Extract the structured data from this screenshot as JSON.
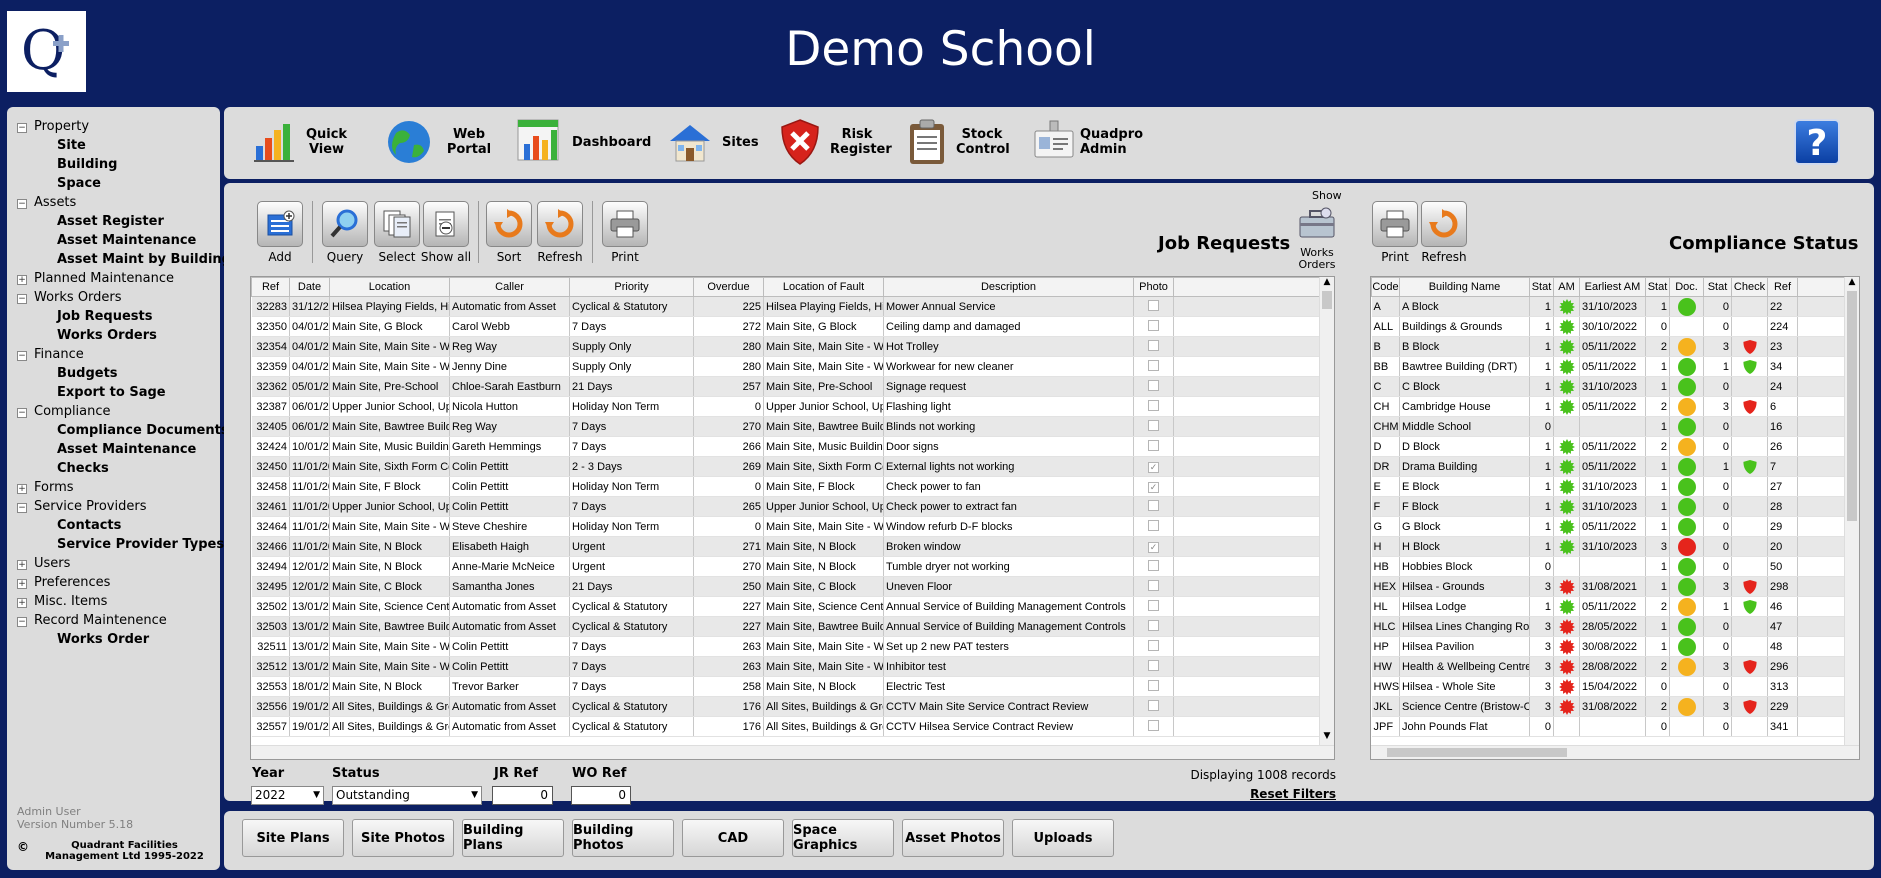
{
  "header": {
    "title": "Demo School"
  },
  "sidebar": {
    "items": [
      {
        "label": "Property",
        "type": "group",
        "toggle": "−"
      },
      {
        "label": "Site",
        "type": "sub"
      },
      {
        "label": "Building",
        "type": "sub"
      },
      {
        "label": "Space",
        "type": "sub"
      },
      {
        "label": "Assets",
        "type": "group",
        "toggle": "−"
      },
      {
        "label": "Asset Register",
        "type": "sub"
      },
      {
        "label": "Asset Maintenance",
        "type": "sub"
      },
      {
        "label": "Asset Maint by Building",
        "type": "sub"
      },
      {
        "label": "Planned Maintenance",
        "type": "group",
        "toggle": "+"
      },
      {
        "label": "Works Orders",
        "type": "group",
        "toggle": "−"
      },
      {
        "label": "Job Requests",
        "type": "sub"
      },
      {
        "label": "Works Orders",
        "type": "sub"
      },
      {
        "label": "Finance",
        "type": "group",
        "toggle": "−"
      },
      {
        "label": "Budgets",
        "type": "sub"
      },
      {
        "label": "Export to Sage",
        "type": "sub"
      },
      {
        "label": "Compliance",
        "type": "group",
        "toggle": "−"
      },
      {
        "label": "Compliance Documents",
        "type": "sub"
      },
      {
        "label": "Asset Maintenance",
        "type": "sub"
      },
      {
        "label": "Checks",
        "type": "sub"
      },
      {
        "label": "Forms",
        "type": "group",
        "toggle": "+"
      },
      {
        "label": "Service Providers",
        "type": "group",
        "toggle": "−"
      },
      {
        "label": "Contacts",
        "type": "sub"
      },
      {
        "label": "Service Provider Types",
        "type": "sub"
      },
      {
        "label": "Users",
        "type": "group",
        "toggle": "+"
      },
      {
        "label": "Preferences",
        "type": "group",
        "toggle": "+"
      },
      {
        "label": "Misc. Items",
        "type": "group",
        "toggle": "+"
      },
      {
        "label": "Record Maintenence",
        "type": "group",
        "toggle": "−"
      },
      {
        "label": "Works Order",
        "type": "sub"
      }
    ],
    "user": "Admin User",
    "version": "Version Number 5.18",
    "copyright_symbol": "©",
    "copyright": "Quadrant Facilities Management Ltd 1995-2022"
  },
  "topbar": {
    "quick_view": "Quick View",
    "web_portal": "Web Portal",
    "dashboard": "Dashboard",
    "sites": "Sites",
    "risk_register": "Risk Register",
    "stock_control": "Stock Control",
    "quadpro_admin": "Quadpro Admin",
    "help": "?"
  },
  "jobs": {
    "title": "Job Requests",
    "toolbar": {
      "add": "Add",
      "query": "Query",
      "select": "Select",
      "show_all": "Show all",
      "sort": "Sort",
      "refresh": "Refresh",
      "print": "Print",
      "show": "Show",
      "works_orders": "Works Orders"
    },
    "columns": [
      "Ref",
      "Date",
      "Location",
      "Caller",
      "Priority",
      "Overdue",
      "Location of Fault",
      "Description",
      "Photo"
    ],
    "rows": [
      [
        "32283",
        "31/12/2021",
        "Hilsea Playing Fields, Hils",
        "Automatic from Asset",
        "Cyclical & Statutory",
        "225",
        "Hilsea Playing Fields, Hils",
        "Mower Annual Service",
        false
      ],
      [
        "32350",
        "04/01/2022",
        "Main Site, G Block",
        "Carol Webb",
        "7 Days",
        "272",
        "Main Site, G Block",
        "Ceiling damp and damaged",
        false
      ],
      [
        "32354",
        "04/01/2022",
        "Main Site, Main Site - Wh",
        "Reg Way",
        "Supply Only",
        "280",
        "Main Site, Main Site - Wh",
        "Hot Trolley",
        false
      ],
      [
        "32359",
        "04/01/2022",
        "Main Site, Main Site - Wh",
        "Jenny Dine",
        "Supply Only",
        "280",
        "Main Site, Main Site - Wh",
        "Workwear for new cleaner",
        false
      ],
      [
        "32362",
        "05/01/2022",
        "Main Site, Pre-School",
        "Chloe-Sarah Eastburn",
        "21 Days",
        "257",
        "Main Site, Pre-School",
        "Signage request",
        false
      ],
      [
        "32387",
        "06/01/2022",
        "Upper Junior School, Upp",
        "Nicola Hutton",
        "Holiday Non Term",
        "0",
        "Upper Junior School, Upp",
        "Flashing light",
        false
      ],
      [
        "32405",
        "06/01/2022",
        "Main Site, Bawtree Buildi",
        "Reg Way",
        "7 Days",
        "270",
        "Main Site, Bawtree Buildi",
        "Blinds not working",
        false
      ],
      [
        "32424",
        "10/01/2022",
        "Main Site, Music Building",
        "Gareth Hemmings",
        "7 Days",
        "266",
        "Main Site, Music Building",
        "Door signs",
        false
      ],
      [
        "32450",
        "11/01/2022",
        "Main Site, Sixth Form Ce",
        "Colin Pettitt",
        "2 - 3 Days",
        "269",
        "Main Site, Sixth Form Ce",
        "External lights not working",
        true
      ],
      [
        "32458",
        "11/01/2022",
        "Main Site, F Block",
        "Colin Pettitt",
        "Holiday Non Term",
        "0",
        "Main Site, F Block",
        "Check power to fan",
        true
      ],
      [
        "32461",
        "11/01/2022",
        "Upper Junior School, Upp",
        "Colin Pettitt",
        "7 Days",
        "265",
        "Upper Junior School, Upp",
        "Check power to extract fan",
        false
      ],
      [
        "32464",
        "11/01/2022",
        "Main Site, Main Site - Wh",
        "Steve Cheshire",
        "Holiday Non Term",
        "0",
        "Main Site, Main Site - Wh",
        "Window refurb D-F blocks",
        false
      ],
      [
        "32466",
        "11/01/2022",
        "Main Site, N Block",
        "Elisabeth Haigh",
        "Urgent",
        "271",
        "Main Site, N Block",
        "Broken window",
        true
      ],
      [
        "32494",
        "12/01/2022",
        "Main Site, N Block",
        "Anne-Marie McNeice",
        "Urgent",
        "270",
        "Main Site, N Block",
        "Tumble dryer not working",
        false
      ],
      [
        "32495",
        "12/01/2022",
        "Main Site, C Block",
        "Samantha Jones",
        "21 Days",
        "250",
        "Main Site, C Block",
        "Uneven Floor",
        false
      ],
      [
        "32502",
        "13/01/2022",
        "Main Site, Science Centr",
        "Automatic from Asset",
        "Cyclical & Statutory",
        "227",
        "Main Site, Science Centr",
        "Annual Service of Building Management Controls",
        false
      ],
      [
        "32503",
        "13/01/2022",
        "Main Site, Bawtree Buildi",
        "Automatic from Asset",
        "Cyclical & Statutory",
        "227",
        "Main Site, Bawtree Buildi",
        "Annual Service of Building Management Controls",
        false
      ],
      [
        "32511",
        "13/01/2022",
        "Main Site, Main Site - Wh",
        "Colin Pettitt",
        "7 Days",
        "263",
        "Main Site, Main Site - Wh",
        "Set up 2 new PAT testers",
        false
      ],
      [
        "32512",
        "13/01/2022",
        "Main Site, Main Site - Wh",
        "Colin Pettitt",
        "7 Days",
        "263",
        "Main Site, Main Site - Wh",
        "Inhibitor test",
        false
      ],
      [
        "32553",
        "18/01/2022",
        "Main Site, N Block",
        "Trevor Barker",
        "7 Days",
        "258",
        "Main Site, N Block",
        "Electric Test",
        false
      ],
      [
        "32556",
        "19/01/2022",
        "All Sites, Buildings & Grou",
        "Automatic from Asset",
        "Cyclical & Statutory",
        "176",
        "All Sites, Buildings & Grou",
        "CCTV Main Site Service Contract Review",
        false
      ],
      [
        "32557",
        "19/01/2022",
        "All Sites, Buildings & Grou",
        "Automatic from Asset",
        "Cyclical & Statutory",
        "176",
        "All Sites, Buildings & Grou",
        "CCTV Hilsea Service Contract Review",
        false
      ]
    ],
    "filters": {
      "year_label": "Year",
      "year_value": "2022",
      "status_label": "Status",
      "status_value": "Outstanding",
      "jr_label": "JR Ref",
      "jr_value": "0",
      "wo_label": "WO Ref",
      "wo_value": "0",
      "displaying": "Displaying 1008 records",
      "reset": "Reset Filters"
    }
  },
  "compliance": {
    "title": "Compliance Status",
    "toolbar": {
      "print": "Print",
      "refresh": "Refresh"
    },
    "columns": [
      "Code",
      "Building Name",
      "Stat",
      "AM",
      "Earliest AM",
      "Stat",
      "Doc.",
      "Stat",
      "Check",
      "Ref"
    ],
    "rows": [
      {
        "code": "A",
        "name": "A Block",
        "stat1": "1",
        "am": "green",
        "earliest": "31/10/2023",
        "stat2": "1",
        "doc": "green",
        "stat3": "0",
        "check": "",
        "ref": "22"
      },
      {
        "code": "ALL",
        "name": "Buildings & Grounds",
        "stat1": "1",
        "am": "green",
        "earliest": "30/10/2022",
        "stat2": "0",
        "doc": "",
        "stat3": "0",
        "check": "",
        "ref": "224"
      },
      {
        "code": "B",
        "name": "B Block",
        "stat1": "1",
        "am": "green",
        "earliest": "05/11/2022",
        "stat2": "2",
        "doc": "orange",
        "stat3": "3",
        "check": "red",
        "ref": "23"
      },
      {
        "code": "BB",
        "name": "Bawtree Building (DRT)",
        "stat1": "1",
        "am": "green",
        "earliest": "05/11/2022",
        "stat2": "1",
        "doc": "green",
        "stat3": "1",
        "check": "green",
        "ref": "34"
      },
      {
        "code": "C",
        "name": "C Block",
        "stat1": "1",
        "am": "green",
        "earliest": "31/10/2023",
        "stat2": "1",
        "doc": "green",
        "stat3": "0",
        "check": "",
        "ref": "24"
      },
      {
        "code": "CH",
        "name": "Cambridge House",
        "stat1": "1",
        "am": "green",
        "earliest": "05/11/2022",
        "stat2": "2",
        "doc": "orange",
        "stat3": "3",
        "check": "red",
        "ref": "6"
      },
      {
        "code": "CHM",
        "name": "Middle School",
        "stat1": "0",
        "am": "",
        "earliest": "",
        "stat2": "1",
        "doc": "green",
        "stat3": "0",
        "check": "",
        "ref": "16"
      },
      {
        "code": "D",
        "name": "D Block",
        "stat1": "1",
        "am": "green",
        "earliest": "05/11/2022",
        "stat2": "2",
        "doc": "orange",
        "stat3": "0",
        "check": "",
        "ref": "26"
      },
      {
        "code": "DR",
        "name": "Drama Building",
        "stat1": "1",
        "am": "green",
        "earliest": "05/11/2022",
        "stat2": "1",
        "doc": "green",
        "stat3": "1",
        "check": "green",
        "ref": "7"
      },
      {
        "code": "E",
        "name": "E Block",
        "stat1": "1",
        "am": "green",
        "earliest": "31/10/2023",
        "stat2": "1",
        "doc": "green",
        "stat3": "0",
        "check": "",
        "ref": "27"
      },
      {
        "code": "F",
        "name": "F Block",
        "stat1": "1",
        "am": "green",
        "earliest": "31/10/2023",
        "stat2": "1",
        "doc": "green",
        "stat3": "0",
        "check": "",
        "ref": "28"
      },
      {
        "code": "G",
        "name": "G Block",
        "stat1": "1",
        "am": "green",
        "earliest": "05/11/2022",
        "stat2": "1",
        "doc": "green",
        "stat3": "0",
        "check": "",
        "ref": "29"
      },
      {
        "code": "H",
        "name": "H Block",
        "stat1": "1",
        "am": "green",
        "earliest": "31/10/2023",
        "stat2": "3",
        "doc": "red",
        "stat3": "0",
        "check": "",
        "ref": "20"
      },
      {
        "code": "HB",
        "name": "Hobbies Block",
        "stat1": "0",
        "am": "",
        "earliest": "",
        "stat2": "1",
        "doc": "green",
        "stat3": "0",
        "check": "",
        "ref": "50"
      },
      {
        "code": "HEX",
        "name": "Hilsea - Grounds",
        "stat1": "3",
        "am": "red",
        "earliest": "31/08/2021",
        "stat2": "1",
        "doc": "green",
        "stat3": "3",
        "check": "red",
        "ref": "298"
      },
      {
        "code": "HL",
        "name": "Hilsea Lodge",
        "stat1": "1",
        "am": "green",
        "earliest": "05/11/2022",
        "stat2": "2",
        "doc": "orange",
        "stat3": "1",
        "check": "green",
        "ref": "46"
      },
      {
        "code": "HLC",
        "name": "Hilsea Lines Changing Rooms",
        "stat1": "3",
        "am": "red",
        "earliest": "28/05/2022",
        "stat2": "1",
        "doc": "green",
        "stat3": "0",
        "check": "",
        "ref": "47"
      },
      {
        "code": "HP",
        "name": "Hilsea Pavilion",
        "stat1": "3",
        "am": "red",
        "earliest": "30/08/2022",
        "stat2": "1",
        "doc": "green",
        "stat3": "0",
        "check": "",
        "ref": "48"
      },
      {
        "code": "HW",
        "name": "Health & Wellbeing Centre",
        "stat1": "3",
        "am": "red",
        "earliest": "28/08/2022",
        "stat2": "2",
        "doc": "orange",
        "stat3": "3",
        "check": "red",
        "ref": "296"
      },
      {
        "code": "HWS",
        "name": "Hilsea - Whole Site",
        "stat1": "3",
        "am": "red",
        "earliest": "15/04/2022",
        "stat2": "0",
        "doc": "",
        "stat3": "0",
        "check": "",
        "ref": "313"
      },
      {
        "code": "JKL",
        "name": "Science Centre (Bristow-Clavell)",
        "stat1": "3",
        "am": "red",
        "earliest": "31/08/2022",
        "stat2": "2",
        "doc": "orange",
        "stat3": "3",
        "check": "red",
        "ref": "229"
      },
      {
        "code": "JPF",
        "name": "John Pounds Flat",
        "stat1": "0",
        "am": "",
        "earliest": "",
        "stat2": "0",
        "doc": "",
        "stat3": "0",
        "check": "",
        "ref": "341"
      }
    ]
  },
  "bottombar": {
    "site_plans": "Site Plans",
    "site_photos": "Site Photos",
    "building_plans": "Building Plans",
    "building_photos": "Building Photos",
    "cad": "CAD",
    "space_graphics": "Space Graphics",
    "asset_photos": "Asset Photos",
    "uploads": "Uploads"
  },
  "colors": {
    "background": "#0c1f62",
    "panel": "#dcdcdc",
    "green": "#49c21c",
    "orange": "#f5b21f",
    "red": "#e5241c"
  }
}
